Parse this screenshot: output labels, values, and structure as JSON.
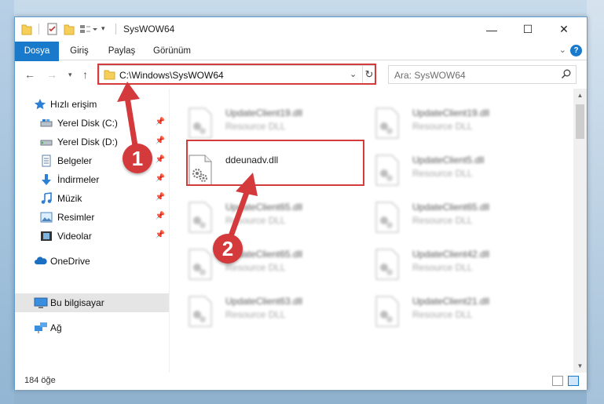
{
  "window": {
    "title": "SysWOW64",
    "controls": {
      "minimize": "—",
      "maximize": "☐",
      "close": "✕"
    }
  },
  "ribbon": {
    "tabs": [
      "Dosya",
      "Giriş",
      "Paylaş",
      "Görünüm"
    ],
    "collapse_icon": "chevron-down-icon",
    "help_label": "?"
  },
  "navigation": {
    "address_path": "C:\\Windows\\SysWOW64",
    "search_placeholder": "Ara: SysWOW64"
  },
  "sidebar": {
    "items": [
      {
        "label": "Hızlı erişim",
        "icon": "star-icon"
      },
      {
        "label": "Yerel Disk (C:)",
        "icon": "drive-icon",
        "pinned": true
      },
      {
        "label": "Yerel Disk (D:)",
        "icon": "drive-icon",
        "pinned": true
      },
      {
        "label": "Belgeler",
        "icon": "documents-icon",
        "pinned": true
      },
      {
        "label": "İndirmeler",
        "icon": "download-icon",
        "pinned": true
      },
      {
        "label": "Müzik",
        "icon": "music-icon",
        "pinned": true
      },
      {
        "label": "Resimler",
        "icon": "pictures-icon",
        "pinned": true
      },
      {
        "label": "Videolar",
        "icon": "videos-icon",
        "pinned": true
      },
      {
        "label": "OneDrive",
        "icon": "cloud-icon"
      },
      {
        "label": "Bu bilgisayar",
        "icon": "computer-icon",
        "selected": true
      },
      {
        "label": "Ağ",
        "icon": "network-icon"
      }
    ]
  },
  "files": {
    "left_column": [
      {
        "name": "UpdateClient19.dll",
        "type": "Resource DLL"
      },
      {
        "name": "ddeunadv.dll",
        "type": ""
      },
      {
        "name": "UpdateClient65.dll",
        "type": "Resource DLL"
      },
      {
        "name": "UpdateClient65.dll",
        "type": "Resource DLL"
      },
      {
        "name": "UpdateClient63.dll",
        "type": "Resource DLL"
      }
    ],
    "right_column": [
      {
        "name": "UpdateClient19.dll",
        "type": "Resource DLL"
      },
      {
        "name": "UpdateClient5.dll",
        "type": "Resource DLL"
      },
      {
        "name": "UpdateClient65.dll",
        "type": "Resource DLL"
      },
      {
        "name": "UpdateClient42.dll",
        "type": "Resource DLL"
      },
      {
        "name": "UpdateClient21.dll",
        "type": "Resource DLL"
      }
    ]
  },
  "status": {
    "item_count": "184 öğe"
  },
  "annotations": {
    "step1": "1",
    "step2": "2",
    "color": "#d4393b"
  }
}
